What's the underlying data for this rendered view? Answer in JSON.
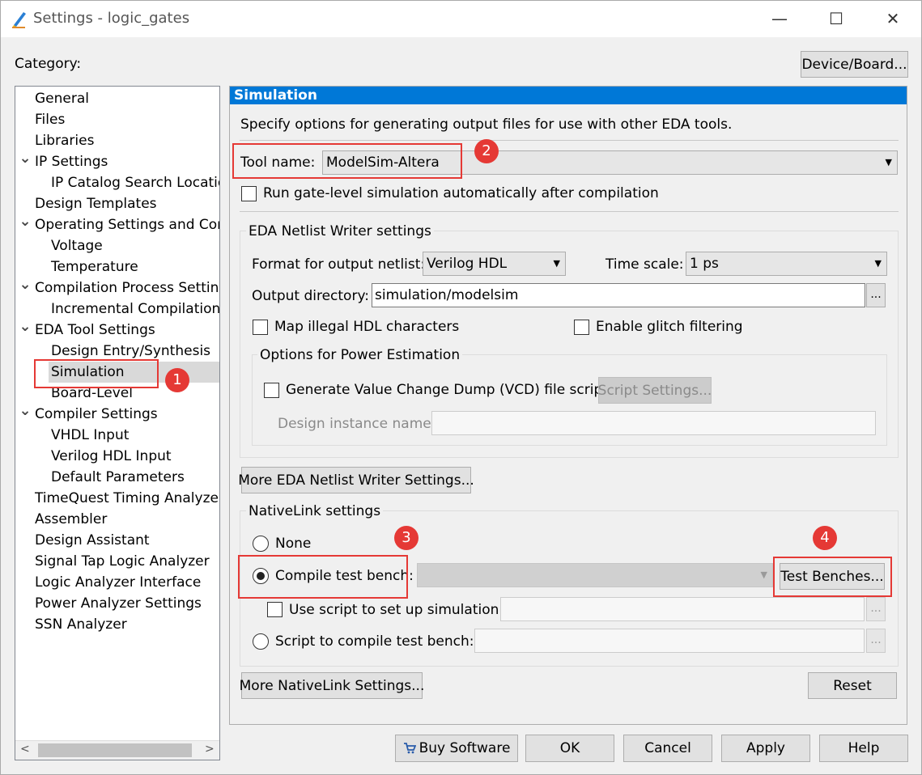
{
  "window": {
    "title": "Settings - logic_gates"
  },
  "header": {
    "category_label": "Category:",
    "device_board_button": "Device/Board..."
  },
  "sidebar": {
    "items": [
      {
        "label": "General",
        "level": 0
      },
      {
        "label": "Files",
        "level": 0
      },
      {
        "label": "Libraries",
        "level": 0
      },
      {
        "label": "IP Settings",
        "level": 0,
        "expanded": true
      },
      {
        "label": "IP Catalog Search Locations",
        "level": 1
      },
      {
        "label": "Design Templates",
        "level": 0
      },
      {
        "label": "Operating Settings and Conditions",
        "level": 0,
        "expanded": true
      },
      {
        "label": "Voltage",
        "level": 1
      },
      {
        "label": "Temperature",
        "level": 1
      },
      {
        "label": "Compilation Process Settings",
        "level": 0,
        "expanded": true
      },
      {
        "label": "Incremental Compilation",
        "level": 1
      },
      {
        "label": "EDA Tool Settings",
        "level": 0,
        "expanded": true
      },
      {
        "label": "Design Entry/Synthesis",
        "level": 1
      },
      {
        "label": "Simulation",
        "level": 1,
        "selected": true
      },
      {
        "label": "Board-Level",
        "level": 1
      },
      {
        "label": "Compiler Settings",
        "level": 0,
        "expanded": true
      },
      {
        "label": "VHDL Input",
        "level": 1
      },
      {
        "label": "Verilog HDL Input",
        "level": 1
      },
      {
        "label": "Default Parameters",
        "level": 1
      },
      {
        "label": "TimeQuest Timing Analyzer",
        "level": 0
      },
      {
        "label": "Assembler",
        "level": 0
      },
      {
        "label": "Design Assistant",
        "level": 0
      },
      {
        "label": "Signal Tap Logic Analyzer",
        "level": 0
      },
      {
        "label": "Logic Analyzer Interface",
        "level": 0
      },
      {
        "label": "Power Analyzer Settings",
        "level": 0
      },
      {
        "label": "SSN Analyzer",
        "level": 0
      }
    ]
  },
  "panel": {
    "title": "Simulation",
    "description": "Specify options for generating output files for use with other EDA tools.",
    "tool_name_label": "Tool name:",
    "tool_name_value": "ModelSim-Altera",
    "run_gate_level_label": "Run gate-level simulation automatically after compilation",
    "eda_netlist": {
      "title": "EDA Netlist Writer settings",
      "format_label": "Format for output netlist:",
      "format_value": "Verilog HDL",
      "time_scale_label": "Time scale:",
      "time_scale_value": "1 ps",
      "output_dir_label": "Output directory:",
      "output_dir_value": "simulation/modelsim",
      "browse": "...",
      "map_illegal_label": "Map illegal HDL characters",
      "glitch_label": "Enable glitch filtering",
      "power": {
        "title": "Options for Power Estimation",
        "vcd_label": "Generate Value Change Dump (VCD) file script",
        "script_settings": "Script Settings...",
        "instance_label": "Design instance name:"
      }
    },
    "more_eda_button": "More EDA Netlist Writer Settings...",
    "nativelink": {
      "title": "NativeLink settings",
      "none_label": "None",
      "compile_tb_label": "Compile test bench:",
      "test_benches_button": "Test Benches...",
      "use_script_label": "Use script to set up simulation:",
      "script_compile_label": "Script to compile test bench:",
      "browse": "..."
    },
    "more_nativelink_button": "More NativeLink Settings...",
    "reset_button": "Reset"
  },
  "footer": {
    "buy_software": "Buy Software",
    "ok": "OK",
    "cancel": "Cancel",
    "apply": "Apply",
    "help": "Help"
  },
  "annotations": [
    "1",
    "2",
    "3",
    "4"
  ],
  "colors": {
    "accent": "#0078d7",
    "annotation": "#e53935"
  }
}
